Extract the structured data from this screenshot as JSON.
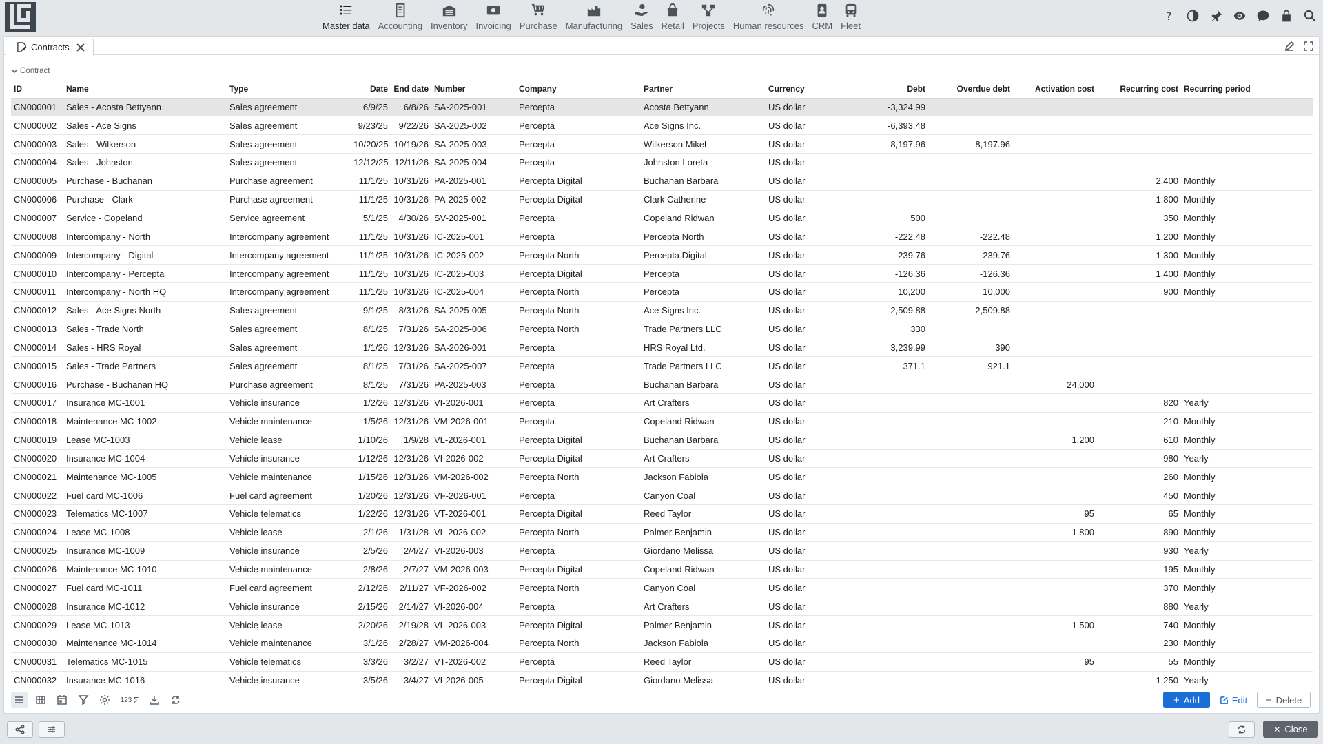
{
  "modules": [
    {
      "label": "Master data",
      "icon": "list-icon",
      "active": true
    },
    {
      "label": "Accounting",
      "icon": "ledger-icon",
      "active": false
    },
    {
      "label": "Inventory",
      "icon": "warehouse-icon",
      "active": false
    },
    {
      "label": "Invoicing",
      "icon": "money-icon",
      "active": false
    },
    {
      "label": "Purchase",
      "icon": "cart-icon",
      "active": false
    },
    {
      "label": "Manufacturing",
      "icon": "factory-icon",
      "active": false
    },
    {
      "label": "Sales",
      "icon": "hand-coin-icon",
      "active": false
    },
    {
      "label": "Retail",
      "icon": "shopping-bag-icon",
      "active": false
    },
    {
      "label": "Projects",
      "icon": "project-icon",
      "active": false
    },
    {
      "label": "Human resources",
      "icon": "fingerprint-icon",
      "active": false
    },
    {
      "label": "CRM",
      "icon": "contact-card-icon",
      "active": false
    },
    {
      "label": "Fleet",
      "icon": "bus-icon",
      "active": false
    }
  ],
  "tab": {
    "label": "Contracts"
  },
  "section": {
    "title": "Contract"
  },
  "columns": [
    "ID",
    "Name",
    "Type",
    "Date",
    "End date",
    "Number",
    "Company",
    "Partner",
    "Currency",
    "Debt",
    "Overdue debt",
    "Activation cost",
    "Recurring cost",
    "Recurring period"
  ],
  "rows": [
    [
      "CN000001",
      "Sales - Acosta Bettyann",
      "Sales agreement",
      "6/9/25",
      "6/8/26",
      "SA-2025-001",
      "Percepta",
      "Acosta Bettyann",
      "US dollar",
      "-3,324.99",
      "",
      "",
      "",
      ""
    ],
    [
      "CN000002",
      "Sales - Ace Signs",
      "Sales agreement",
      "9/23/25",
      "9/22/26",
      "SA-2025-002",
      "Percepta",
      "Ace Signs Inc.",
      "US dollar",
      "-6,393.48",
      "",
      "",
      "",
      ""
    ],
    [
      "CN000003",
      "Sales - Wilkerson",
      "Sales agreement",
      "10/20/25",
      "10/19/26",
      "SA-2025-003",
      "Percepta",
      "Wilkerson Mikel",
      "US dollar",
      "8,197.96",
      "8,197.96",
      "",
      "",
      ""
    ],
    [
      "CN000004",
      "Sales - Johnston",
      "Sales agreement",
      "12/12/25",
      "12/11/26",
      "SA-2025-004",
      "Percepta",
      "Johnston Loreta",
      "US dollar",
      "",
      "",
      "",
      "",
      ""
    ],
    [
      "CN000005",
      "Purchase - Buchanan",
      "Purchase agreement",
      "11/1/25",
      "10/31/26",
      "PA-2025-001",
      "Percepta Digital",
      "Buchanan Barbara",
      "US dollar",
      "",
      "",
      "",
      "2,400",
      "Monthly"
    ],
    [
      "CN000006",
      "Purchase - Clark",
      "Purchase agreement",
      "11/1/25",
      "10/31/26",
      "PA-2025-002",
      "Percepta Digital",
      "Clark Catherine",
      "US dollar",
      "",
      "",
      "",
      "1,800",
      "Monthly"
    ],
    [
      "CN000007",
      "Service - Copeland",
      "Service agreement",
      "5/1/25",
      "4/30/26",
      "SV-2025-001",
      "Percepta",
      "Copeland Ridwan",
      "US dollar",
      "500",
      "",
      "",
      "350",
      "Monthly"
    ],
    [
      "CN000008",
      "Intercompany - North",
      "Intercompany agreement",
      "11/1/25",
      "10/31/26",
      "IC-2025-001",
      "Percepta",
      "Percepta North",
      "US dollar",
      "-222.48",
      "-222.48",
      "",
      "1,200",
      "Monthly"
    ],
    [
      "CN000009",
      "Intercompany - Digital",
      "Intercompany agreement",
      "11/1/25",
      "10/31/26",
      "IC-2025-002",
      "Percepta North",
      "Percepta Digital",
      "US dollar",
      "-239.76",
      "-239.76",
      "",
      "1,300",
      "Monthly"
    ],
    [
      "CN000010",
      "Intercompany - Percepta",
      "Intercompany agreement",
      "11/1/25",
      "10/31/26",
      "IC-2025-003",
      "Percepta Digital",
      "Percepta",
      "US dollar",
      "-126.36",
      "-126.36",
      "",
      "1,400",
      "Monthly"
    ],
    [
      "CN000011",
      "Intercompany - North HQ",
      "Intercompany agreement",
      "11/1/25",
      "10/31/26",
      "IC-2025-004",
      "Percepta North",
      "Percepta",
      "US dollar",
      "10,200",
      "10,000",
      "",
      "900",
      "Monthly"
    ],
    [
      "CN000012",
      "Sales - Ace Signs North",
      "Sales agreement",
      "9/1/25",
      "8/31/26",
      "SA-2025-005",
      "Percepta North",
      "Ace Signs Inc.",
      "US dollar",
      "2,509.88",
      "2,509.88",
      "",
      "",
      ""
    ],
    [
      "CN000013",
      "Sales - Trade North",
      "Sales agreement",
      "8/1/25",
      "7/31/26",
      "SA-2025-006",
      "Percepta North",
      "Trade Partners LLC",
      "US dollar",
      "330",
      "",
      "",
      "",
      ""
    ],
    [
      "CN000014",
      "Sales - HRS Royal",
      "Sales agreement",
      "1/1/26",
      "12/31/26",
      "SA-2026-001",
      "Percepta",
      "HRS Royal Ltd.",
      "US dollar",
      "3,239.99",
      "390",
      "",
      "",
      ""
    ],
    [
      "CN000015",
      "Sales - Trade Partners",
      "Sales agreement",
      "8/1/25",
      "7/31/26",
      "SA-2025-007",
      "Percepta",
      "Trade Partners LLC",
      "US dollar",
      "371.1",
      "921.1",
      "",
      "",
      ""
    ],
    [
      "CN000016",
      "Purchase - Buchanan HQ",
      "Purchase agreement",
      "8/1/25",
      "7/31/26",
      "PA-2025-003",
      "Percepta",
      "Buchanan Barbara",
      "US dollar",
      "",
      "",
      "24,000",
      "",
      ""
    ],
    [
      "CN000017",
      "Insurance MC-1001",
      "Vehicle insurance",
      "1/2/26",
      "12/31/26",
      "VI-2026-001",
      "Percepta",
      "Art Crafters",
      "US dollar",
      "",
      "",
      "",
      "820",
      "Yearly"
    ],
    [
      "CN000018",
      "Maintenance MC-1002",
      "Vehicle maintenance",
      "1/5/26",
      "12/31/26",
      "VM-2026-001",
      "Percepta",
      "Copeland Ridwan",
      "US dollar",
      "",
      "",
      "",
      "210",
      "Monthly"
    ],
    [
      "CN000019",
      "Lease MC-1003",
      "Vehicle lease",
      "1/10/26",
      "1/9/28",
      "VL-2026-001",
      "Percepta Digital",
      "Buchanan Barbara",
      "US dollar",
      "",
      "",
      "1,200",
      "610",
      "Monthly"
    ],
    [
      "CN000020",
      "Insurance MC-1004",
      "Vehicle insurance",
      "1/12/26",
      "12/31/26",
      "VI-2026-002",
      "Percepta Digital",
      "Art Crafters",
      "US dollar",
      "",
      "",
      "",
      "980",
      "Yearly"
    ],
    [
      "CN000021",
      "Maintenance MC-1005",
      "Vehicle maintenance",
      "1/15/26",
      "12/31/26",
      "VM-2026-002",
      "Percepta North",
      "Jackson Fabiola",
      "US dollar",
      "",
      "",
      "",
      "260",
      "Monthly"
    ],
    [
      "CN000022",
      "Fuel card MC-1006",
      "Fuel card agreement",
      "1/20/26",
      "12/31/26",
      "VF-2026-001",
      "Percepta",
      "Canyon Coal",
      "US dollar",
      "",
      "",
      "",
      "450",
      "Monthly"
    ],
    [
      "CN000023",
      "Telematics MC-1007",
      "Vehicle telematics",
      "1/22/26",
      "12/31/26",
      "VT-2026-001",
      "Percepta Digital",
      "Reed Taylor",
      "US dollar",
      "",
      "",
      "95",
      "65",
      "Monthly"
    ],
    [
      "CN000024",
      "Lease MC-1008",
      "Vehicle lease",
      "2/1/26",
      "1/31/28",
      "VL-2026-002",
      "Percepta North",
      "Palmer Benjamin",
      "US dollar",
      "",
      "",
      "1,800",
      "890",
      "Monthly"
    ],
    [
      "CN000025",
      "Insurance MC-1009",
      "Vehicle insurance",
      "2/5/26",
      "2/4/27",
      "VI-2026-003",
      "Percepta",
      "Giordano Melissa",
      "US dollar",
      "",
      "",
      "",
      "930",
      "Yearly"
    ],
    [
      "CN000026",
      "Maintenance MC-1010",
      "Vehicle maintenance",
      "2/8/26",
      "2/7/27",
      "VM-2026-003",
      "Percepta Digital",
      "Copeland Ridwan",
      "US dollar",
      "",
      "",
      "",
      "195",
      "Monthly"
    ],
    [
      "CN000027",
      "Fuel card MC-1011",
      "Fuel card agreement",
      "2/12/26",
      "2/11/27",
      "VF-2026-002",
      "Percepta North",
      "Canyon Coal",
      "US dollar",
      "",
      "",
      "",
      "370",
      "Monthly"
    ],
    [
      "CN000028",
      "Insurance MC-1012",
      "Vehicle insurance",
      "2/15/26",
      "2/14/27",
      "VI-2026-004",
      "Percepta",
      "Art Crafters",
      "US dollar",
      "",
      "",
      "",
      "880",
      "Yearly"
    ],
    [
      "CN000029",
      "Lease MC-1013",
      "Vehicle lease",
      "2/20/26",
      "2/19/28",
      "VL-2026-003",
      "Percepta Digital",
      "Palmer Benjamin",
      "US dollar",
      "",
      "",
      "1,500",
      "740",
      "Monthly"
    ],
    [
      "CN000030",
      "Maintenance MC-1014",
      "Vehicle maintenance",
      "3/1/26",
      "2/28/27",
      "VM-2026-004",
      "Percepta North",
      "Jackson Fabiola",
      "US dollar",
      "",
      "",
      "",
      "230",
      "Monthly"
    ],
    [
      "CN000031",
      "Telematics MC-1015",
      "Vehicle telematics",
      "3/3/26",
      "3/2/27",
      "VT-2026-002",
      "Percepta",
      "Reed Taylor",
      "US dollar",
      "",
      "",
      "95",
      "55",
      "Monthly"
    ],
    [
      "CN000032",
      "Insurance MC-1016",
      "Vehicle insurance",
      "3/5/26",
      "3/4/27",
      "VI-2026-005",
      "Percepta Digital",
      "Giordano Melissa",
      "US dollar",
      "",
      "",
      "",
      "1,250",
      "Yearly"
    ]
  ],
  "selected_row": 0,
  "grid_toolbar": {
    "sum_label": "123"
  },
  "actions": {
    "add": "Add",
    "edit": "Edit",
    "delete": "Delete"
  },
  "footer": {
    "close": "Close"
  },
  "colors": {
    "accent": "#1a6fd6",
    "selected_row": "#e5e5e5",
    "close_button": "#5d646c"
  }
}
